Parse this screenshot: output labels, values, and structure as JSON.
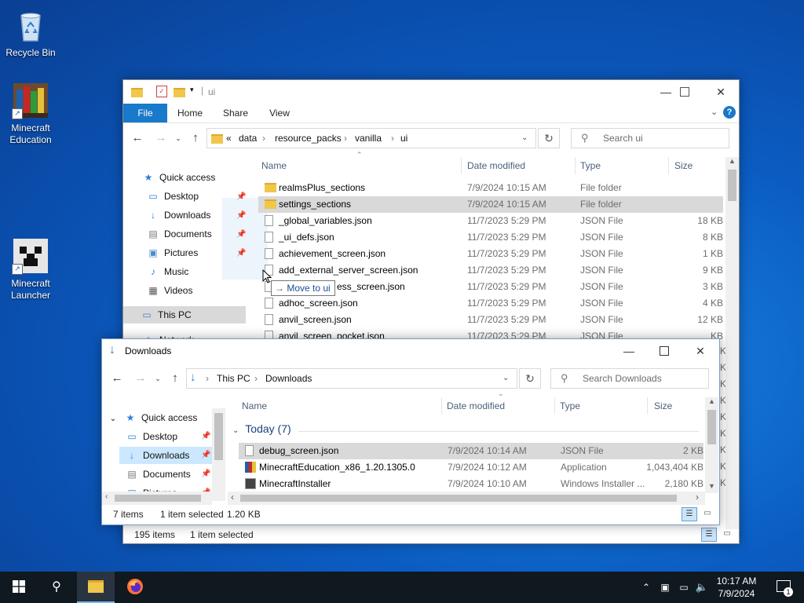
{
  "desktop": {
    "icons": [
      {
        "label": "Recycle Bin"
      },
      {
        "label": "Minecraft Education"
      },
      {
        "label": "Minecraft Launcher"
      }
    ]
  },
  "back_window": {
    "title": "ui",
    "tabs": [
      "File",
      "Home",
      "Share",
      "View"
    ],
    "breadcrumb": [
      "«",
      "data",
      "resource_packs",
      "vanilla",
      "ui"
    ],
    "search_placeholder": "Search ui",
    "nav": {
      "quick_access": "Quick access",
      "items": [
        "Desktop",
        "Downloads",
        "Documents",
        "Pictures",
        "Music",
        "Videos"
      ],
      "this_pc": "This PC",
      "network": "Network"
    },
    "columns": {
      "name": "Name",
      "date": "Date modified",
      "type": "Type",
      "size": "Size"
    },
    "rows": [
      {
        "name": "realmsPlus_sections",
        "date": "7/9/2024 10:15 AM",
        "type": "File folder",
        "size": "",
        "folder": true
      },
      {
        "name": "settings_sections",
        "date": "7/9/2024 10:15 AM",
        "type": "File folder",
        "size": "",
        "folder": true
      },
      {
        "name": "_global_variables.json",
        "date": "11/7/2023 5:29 PM",
        "type": "JSON File",
        "size": "18 KB"
      },
      {
        "name": "_ui_defs.json",
        "date": "11/7/2023 5:29 PM",
        "type": "JSON File",
        "size": "8 KB"
      },
      {
        "name": "achievement_screen.json",
        "date": "11/7/2023 5:29 PM",
        "type": "JSON File",
        "size": "1 KB"
      },
      {
        "name": "add_external_server_screen.json",
        "date": "11/7/2023 5:29 PM",
        "type": "JSON File",
        "size": "9 KB"
      },
      {
        "name": "ess_screen.json",
        "date": "11/7/2023 5:29 PM",
        "type": "JSON File",
        "size": "3 KB"
      },
      {
        "name": "adhoc_screen.json",
        "date": "11/7/2023 5:29 PM",
        "type": "JSON File",
        "size": "4 KB"
      },
      {
        "name": "anvil_screen.json",
        "date": "11/7/2023 5:29 PM",
        "type": "JSON File",
        "size": "12 KB"
      },
      {
        "name": "anvil_screen_pocket.json",
        "date": "11/7/2023 5:29 PM",
        "type": "JSON File",
        "size": "KB"
      }
    ],
    "right_edge_sizes": [
      "KB",
      "KB",
      "KB",
      "KB",
      "KB",
      "KB",
      "KB",
      "KB",
      "KB"
    ],
    "drag_tooltip": "Move to ui",
    "status": {
      "count": "195 items",
      "selected": "1 item selected"
    }
  },
  "front_window": {
    "title": "Downloads",
    "breadcrumb": [
      "This PC",
      "Downloads"
    ],
    "search_placeholder": "Search Downloads",
    "nav": {
      "quick_access": "Quick access",
      "items": [
        "Desktop",
        "Downloads",
        "Documents",
        "Pictures"
      ]
    },
    "columns": {
      "name": "Name",
      "date": "Date modified",
      "type": "Type",
      "size": "Size"
    },
    "group": "Today (7)",
    "rows": [
      {
        "name": "debug_screen.json",
        "date": "7/9/2024 10:14 AM",
        "type": "JSON File",
        "size": "2 KB"
      },
      {
        "name": "MinecraftEducation_x86_1.20.1305.0",
        "date": "7/9/2024 10:12 AM",
        "type": "Application",
        "size": "1,043,404 KB"
      },
      {
        "name": "MinecraftInstaller",
        "date": "7/9/2024 10:10 AM",
        "type": "Windows Installer ...",
        "size": "2,180 KB"
      }
    ],
    "status": {
      "count": "7 items",
      "selected": "1 item selected",
      "size": "1.20 KB"
    }
  },
  "taskbar": {
    "time": "10:17 AM",
    "date": "7/9/2024",
    "notifications": "1"
  }
}
